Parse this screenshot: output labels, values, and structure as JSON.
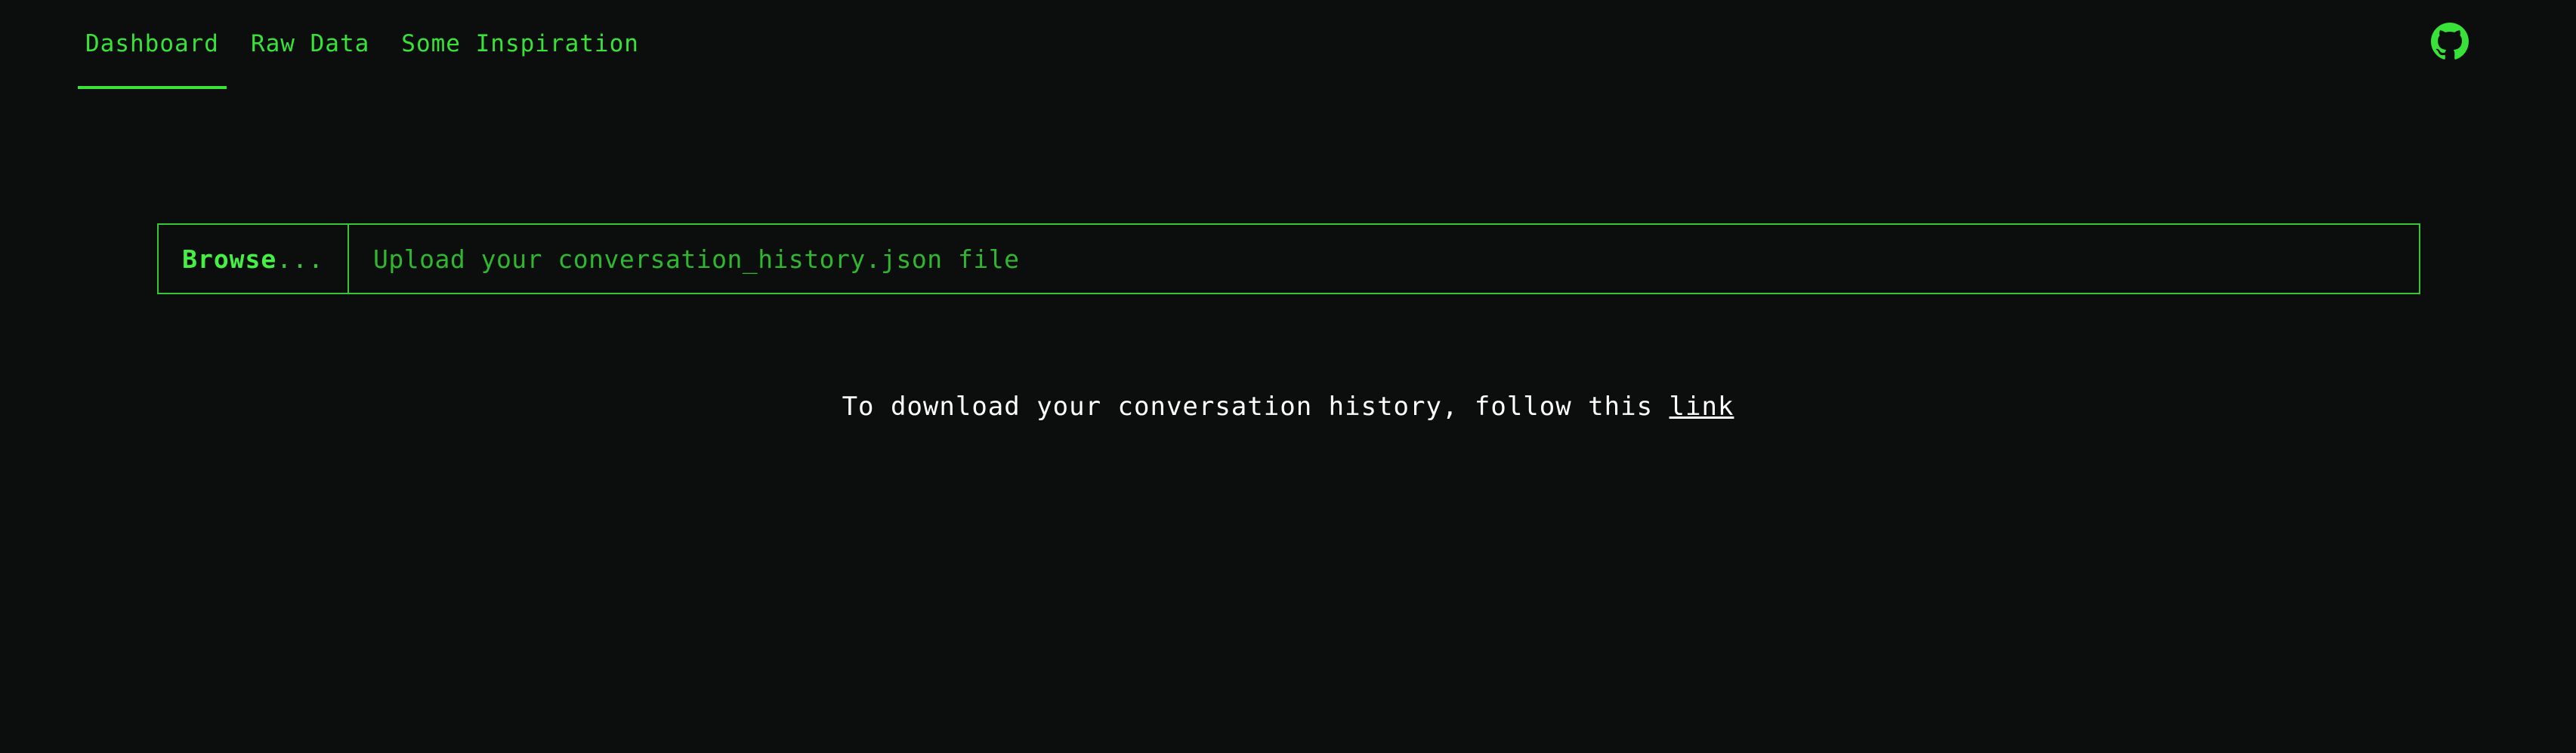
{
  "nav": {
    "tabs": [
      {
        "label": "Dashboard",
        "active": true
      },
      {
        "label": "Raw Data",
        "active": false
      },
      {
        "label": "Some Inspiration",
        "active": false
      }
    ],
    "github_icon": "github-icon"
  },
  "upload": {
    "button_label": "Browse",
    "button_suffix": "...",
    "placeholder": "Upload your conversation_history.json file"
  },
  "hint": {
    "text": "To download your conversation history, follow this ",
    "link_label": "link"
  },
  "colors": {
    "background": "#0c0d0d",
    "accent": "#39e239",
    "text": "#ffffff"
  }
}
